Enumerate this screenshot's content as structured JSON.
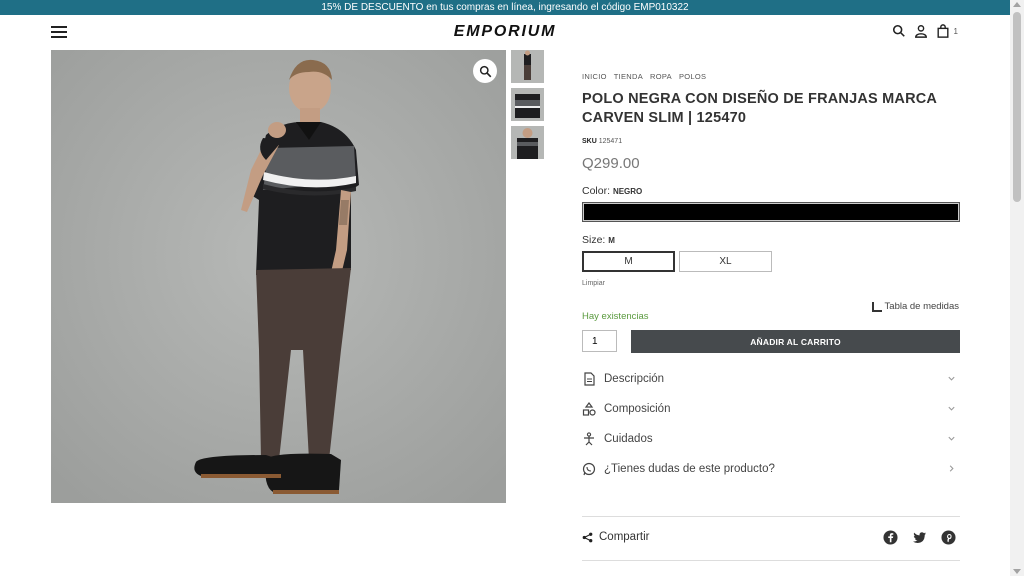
{
  "promo": {
    "text": "15% DE DESCUENTO en tus compras en línea, ingresando el código EMP010322"
  },
  "header": {
    "logo": "EMPORIUM",
    "cart_count": "1"
  },
  "breadcrumb": [
    "INICIO",
    "TIENDA",
    "ROPA",
    "POLOS"
  ],
  "product": {
    "title": "POLO NEGRA CON DISEÑO DE FRANJAS MARCA CARVEN SLIM | 125470",
    "sku_label": "SKU",
    "sku": "125471",
    "price": "Q299.00",
    "color_label": "Color:",
    "color_value": "NEGRO",
    "color_swatch": "#000000",
    "size_label": "Size:",
    "size_value": "M",
    "sizes": [
      "M",
      "XL"
    ],
    "clear_label": "Limpiar",
    "stock": "Hay existencias",
    "size_chart": "Tabla de medidas",
    "quantity": "1",
    "add_to_cart": "AÑADIR AL CARRITO"
  },
  "accordion": [
    "Descripción",
    "Composición",
    "Cuidados",
    "¿Tienes dudas de este producto?"
  ],
  "share": {
    "label": "Compartir",
    "networks": [
      "facebook-icon",
      "twitter-icon",
      "pinterest-icon"
    ]
  },
  "colors": {
    "promo_bg": "#1f6f86",
    "button_bg": "#464a4d",
    "stock_green": "#5a9a3e"
  }
}
